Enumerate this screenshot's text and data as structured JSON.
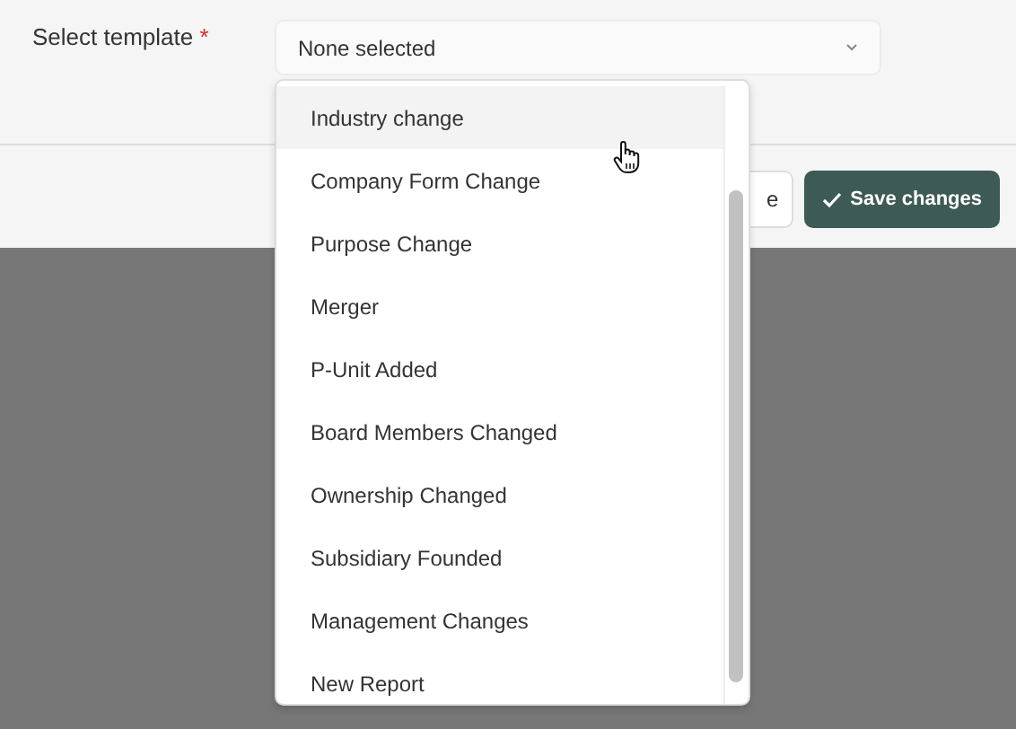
{
  "form": {
    "label": "Select template",
    "required_mark": "*",
    "select": {
      "value": "None selected"
    }
  },
  "dropdown": {
    "options": [
      {
        "label": "Industry change",
        "highlighted": true
      },
      {
        "label": "Company Form Change",
        "highlighted": false
      },
      {
        "label": "Purpose Change",
        "highlighted": false
      },
      {
        "label": "Merger",
        "highlighted": false
      },
      {
        "label": "P-Unit Added",
        "highlighted": false
      },
      {
        "label": "Board Members Changed",
        "highlighted": false
      },
      {
        "label": "Ownership Changed",
        "highlighted": false
      },
      {
        "label": "Subsidiary Founded",
        "highlighted": false
      },
      {
        "label": "Management Changes",
        "highlighted": false
      },
      {
        "label": "New Report",
        "highlighted": false
      }
    ]
  },
  "footer": {
    "buttons": [
      {
        "kind": "secondary",
        "label": "e"
      },
      {
        "kind": "primary",
        "label": "Save changes"
      }
    ]
  }
}
